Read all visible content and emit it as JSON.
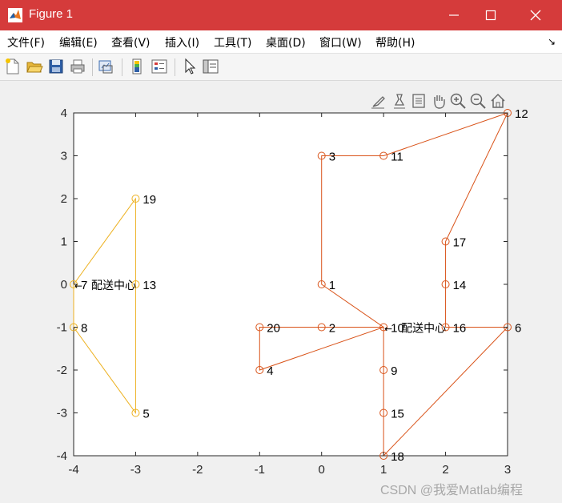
{
  "window": {
    "title": "Figure 1",
    "minimize_icon": "minimize-icon",
    "maximize_icon": "maximize-icon",
    "close_icon": "close-icon",
    "title_bar_color": "#d53b3b"
  },
  "menu": {
    "items": [
      "文件(F)",
      "编辑(E)",
      "查看(V)",
      "插入(I)",
      "工具(T)",
      "桌面(D)",
      "窗口(W)",
      "帮助(H)"
    ],
    "overflow_icon": "dock-arrow-icon"
  },
  "toolbar": {
    "icons": [
      "new-figure-icon",
      "open-file-icon",
      "save-icon",
      "print-icon",
      "link-plot-icon",
      "colorbar-icon",
      "legend-icon",
      "pointer-icon",
      "property-inspector-icon"
    ]
  },
  "axes_toolbar": {
    "icons": [
      "brush-icon",
      "data-tip-icon",
      "rotate-icon",
      "pan-icon",
      "zoom-in-icon",
      "zoom-out-icon",
      "home-icon"
    ]
  },
  "chart_data": {
    "type": "line",
    "title": "",
    "xlabel": "",
    "ylabel": "",
    "xlim": [
      -4,
      3
    ],
    "ylim": [
      -4,
      4
    ],
    "x_ticks": [
      "-4",
      "-3",
      "-2",
      "-1",
      "0",
      "1",
      "2",
      "3"
    ],
    "y_ticks": [
      "4",
      "3",
      "2",
      "1",
      "0",
      "-1",
      "-2",
      "-3",
      "-4"
    ],
    "grid": false,
    "depot_label": "配送中心",
    "depots": [
      {
        "x": -4,
        "y": 0,
        "color": "#edb120"
      },
      {
        "x": 1,
        "y": -1,
        "color": "#d95319"
      }
    ],
    "series": [
      {
        "color": "#edb120",
        "route": [
          0,
          7,
          8,
          5,
          13,
          19,
          7,
          0
        ],
        "points": [
          {
            "id": "7",
            "x": -4,
            "y": 0
          },
          {
            "id": "8",
            "x": -4,
            "y": -1
          },
          {
            "id": "5",
            "x": -3,
            "y": -3
          },
          {
            "id": "13",
            "x": -3,
            "y": 0
          },
          {
            "id": "19",
            "x": -3,
            "y": 2
          }
        ]
      },
      {
        "color": "#d95319",
        "route": [
          0,
          10,
          2,
          20,
          4,
          10,
          1,
          3,
          11,
          12,
          17,
          14,
          16,
          6,
          18,
          15,
          9,
          10,
          0
        ],
        "points": [
          {
            "id": "10",
            "x": 1,
            "y": -1
          },
          {
            "id": "2",
            "x": 0,
            "y": -1
          },
          {
            "id": "20",
            "x": -1,
            "y": -1
          },
          {
            "id": "4",
            "x": -1,
            "y": -2
          },
          {
            "id": "1",
            "x": 0,
            "y": 0
          },
          {
            "id": "3",
            "x": 0,
            "y": 3
          },
          {
            "id": "11",
            "x": 1,
            "y": 3
          },
          {
            "id": "12",
            "x": 3,
            "y": 4
          },
          {
            "id": "17",
            "x": 2,
            "y": 1
          },
          {
            "id": "14",
            "x": 2,
            "y": 0
          },
          {
            "id": "16",
            "x": 2,
            "y": -1
          },
          {
            "id": "6",
            "x": 3,
            "y": -1
          },
          {
            "id": "18",
            "x": 1,
            "y": -4
          },
          {
            "id": "15",
            "x": 1,
            "y": -3
          },
          {
            "id": "9",
            "x": 1,
            "y": -2
          }
        ]
      }
    ]
  },
  "watermark": "CSDN @我爱Matlab编程"
}
